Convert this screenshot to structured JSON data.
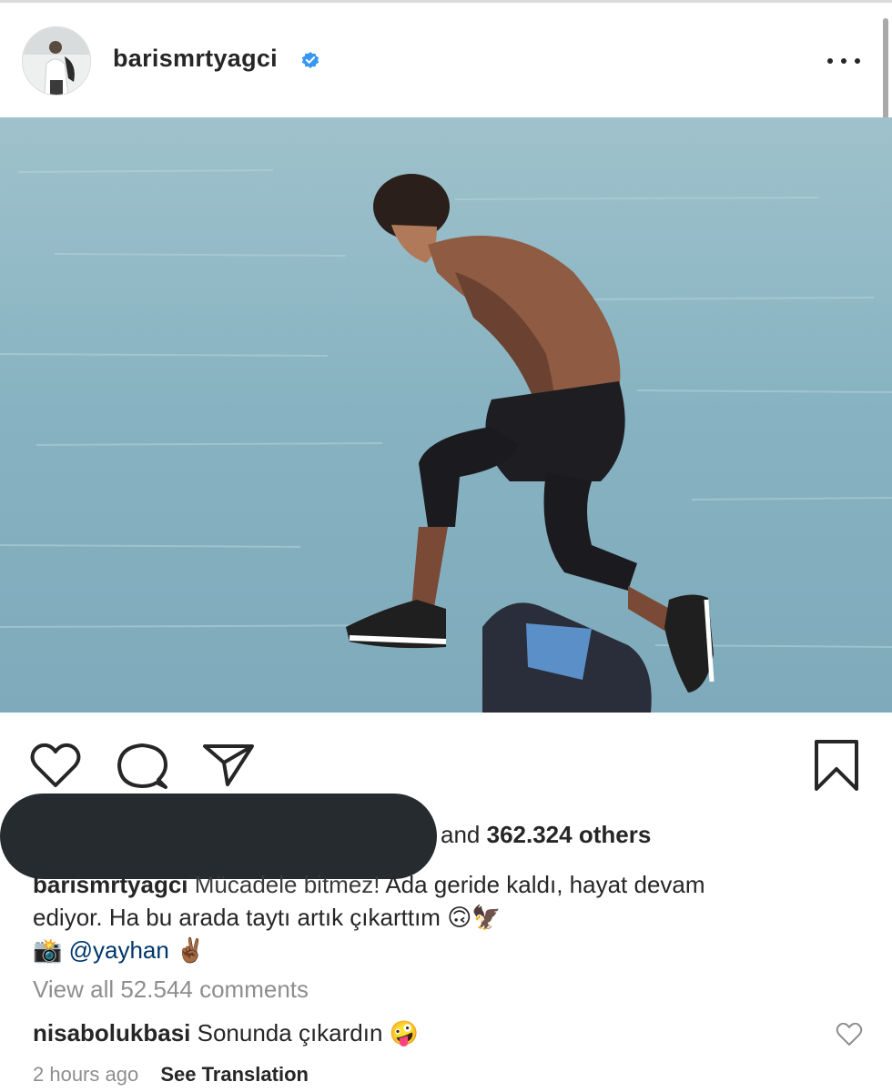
{
  "post": {
    "username": "barismrtyagci",
    "verified": true,
    "likes": {
      "prefix": "and ",
      "count": "362.324 others"
    },
    "caption": {
      "user": "barismrtyagci",
      "text_line1_faded": "Mücadele bitmez!",
      "text_line1": " Ada geride kaldı, hayat devam",
      "text_line2": "ediyor. Ha bu arada taytı artık çıkarttım",
      "emoji_line2": "🙃🦅",
      "camera_emoji": "📸",
      "mention": "@yayhan",
      "peace_emoji": "✌🏾"
    },
    "view_all_comments": "View all 52.544 comments",
    "top_comment": {
      "user": "nisabolukbasi",
      "text": "Sonunda çıkardın",
      "emoji": "🤪"
    },
    "meta": {
      "time": "2 hours ago",
      "see_translation": "See Translation"
    }
  },
  "icons": {
    "more": "more-options-icon",
    "heart": "heart-icon",
    "comment": "comment-icon",
    "share": "share-icon",
    "save": "bookmark-icon",
    "verified": "verified-badge-icon"
  },
  "colors": {
    "verified_blue": "#3897f0",
    "mention_blue": "#00376b",
    "muted_gray": "#8e8e8e",
    "redaction": "#262b2f"
  }
}
